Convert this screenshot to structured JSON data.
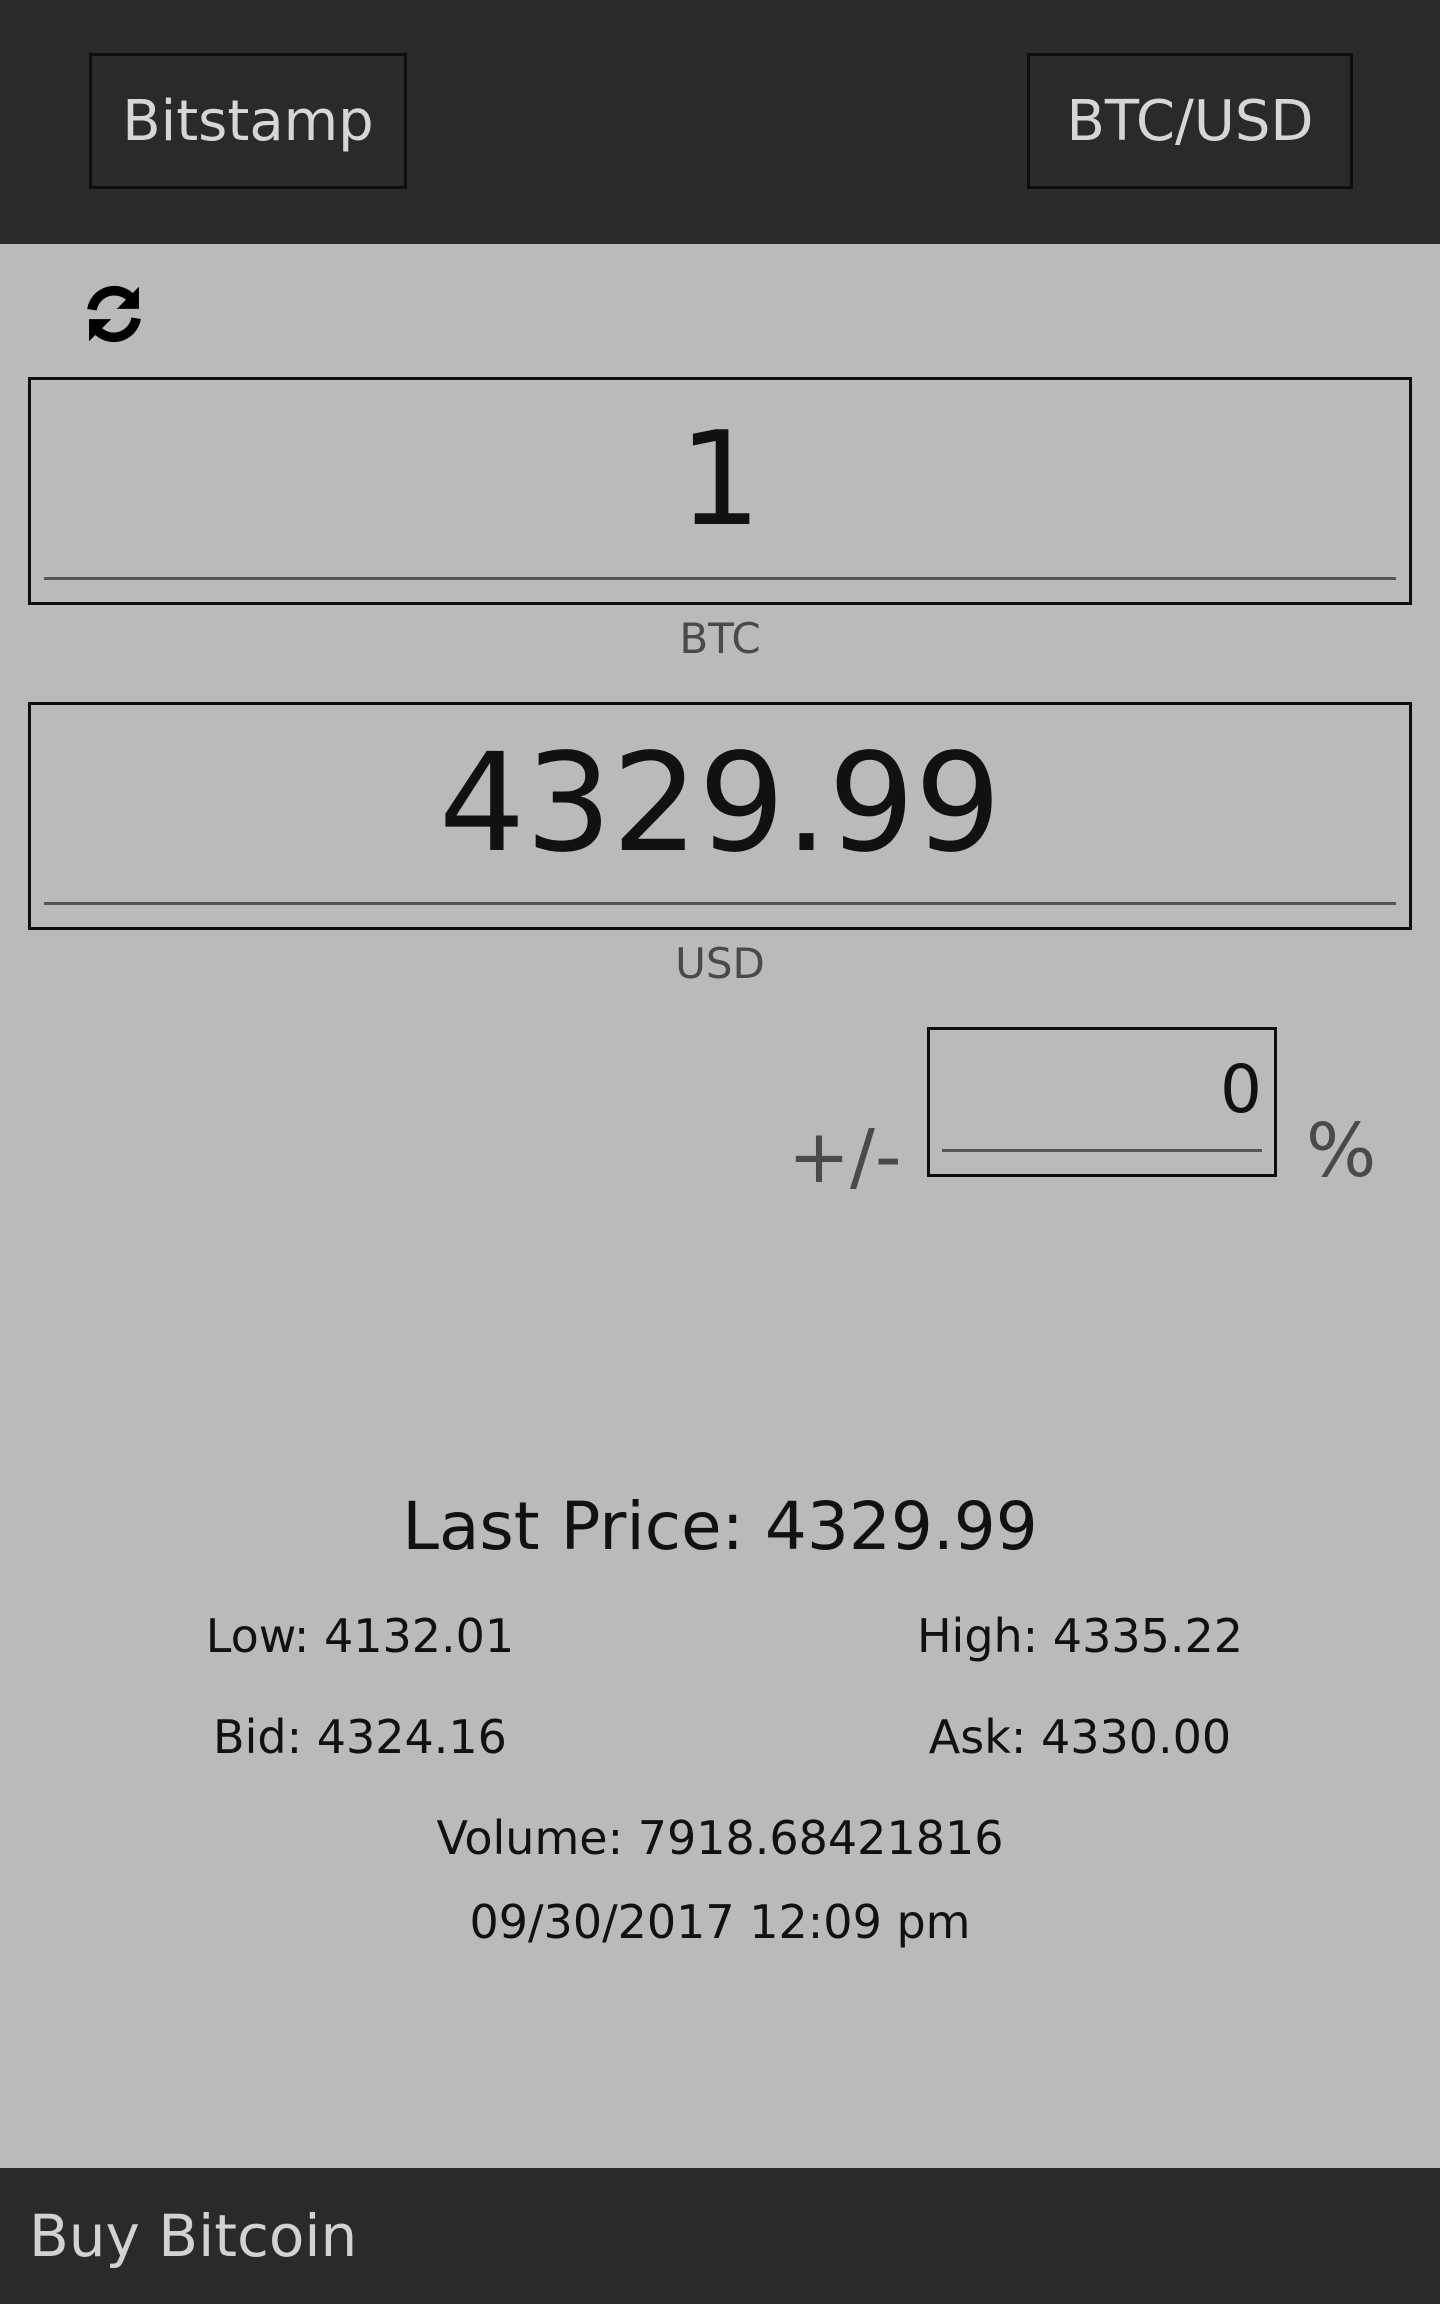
{
  "header": {
    "exchange_label": "Bitstamp",
    "pair_label": "BTC/USD",
    "background_color": "#2a2a2a"
  },
  "refresh": {
    "icon": "refresh-icon"
  },
  "converter": {
    "btc_value": "1",
    "btc_unit": "BTC",
    "usd_value": "4329.99",
    "usd_unit": "USD",
    "adjust_prefix": "+/-",
    "adjust_value": "0",
    "adjust_suffix": "%"
  },
  "ticker": {
    "last_price": "Last Price: 4329.99",
    "low": "Low: 4132.01",
    "high": "High: 4335.22",
    "bid": "Bid: 4324.16",
    "ask": "Ask: 4330.00",
    "volume": "Volume: 7918.68421816",
    "timestamp": "09/30/2017 12:09 pm"
  },
  "footer": {
    "buy_label": "Buy Bitcoin"
  },
  "colors": {
    "background": "#bababa",
    "bar": "#2a2a2a",
    "text": "#111111"
  }
}
